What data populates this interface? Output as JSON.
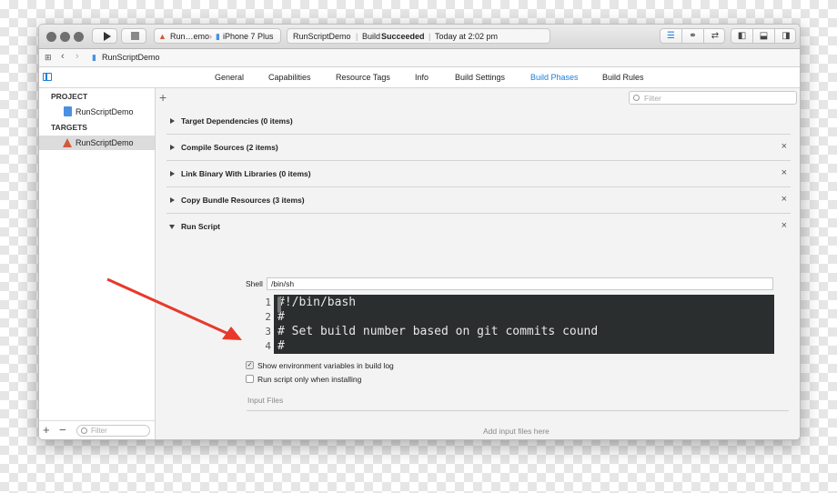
{
  "toolbar": {
    "scheme_target": "Run…emo",
    "scheme_device": "iPhone 7 Plus",
    "activity_project": "RunScriptDemo",
    "activity_build_prefix": "Build",
    "activity_build_status": "Succeeded",
    "activity_time": "Today at 2:02 pm"
  },
  "jumpbar": {
    "file": "RunScriptDemo"
  },
  "tabs": [
    {
      "label": "General"
    },
    {
      "label": "Capabilities"
    },
    {
      "label": "Resource Tags"
    },
    {
      "label": "Info"
    },
    {
      "label": "Build Settings"
    },
    {
      "label": "Build Phases"
    },
    {
      "label": "Build Rules"
    }
  ],
  "active_tab": "Build Phases",
  "sidebar": {
    "project_header": "PROJECT",
    "project_item": "RunScriptDemo",
    "targets_header": "TARGETS",
    "target_item": "RunScriptDemo",
    "filter_placeholder": "Filter"
  },
  "main": {
    "filter_placeholder": "Filter",
    "phases": [
      {
        "title": "Target Dependencies (0 items)",
        "closable": false
      },
      {
        "title": "Compile Sources (2 items)",
        "closable": true
      },
      {
        "title": "Link Binary With Libraries (0 items)",
        "closable": true
      },
      {
        "title": "Copy Bundle Resources (3 items)",
        "closable": true
      },
      {
        "title": "Run Script",
        "closable": true
      }
    ],
    "run_script": {
      "shell_label": "Shell",
      "shell_value": "/bin/sh",
      "script_lines": [
        {
          "num": "1",
          "text": "#!/bin/bash"
        },
        {
          "num": "2",
          "text": "#"
        },
        {
          "num": "3",
          "text": "# Set build number based on git commits cound"
        },
        {
          "num": "4",
          "text": "#"
        }
      ],
      "show_env_label": "Show environment variables in build log",
      "show_env_checked": true,
      "run_only_installing_label": "Run script only when installing",
      "run_only_installing_checked": false,
      "input_files_label": "Input Files",
      "input_files_placeholder": "Add input files here"
    }
  },
  "icons": {
    "close": "×",
    "plus": "+",
    "minus": "−",
    "check": "✓"
  },
  "colors": {
    "accent": "#1b7fe0",
    "arrow": "#e8392b",
    "editor_bg": "#2b2e2f"
  }
}
